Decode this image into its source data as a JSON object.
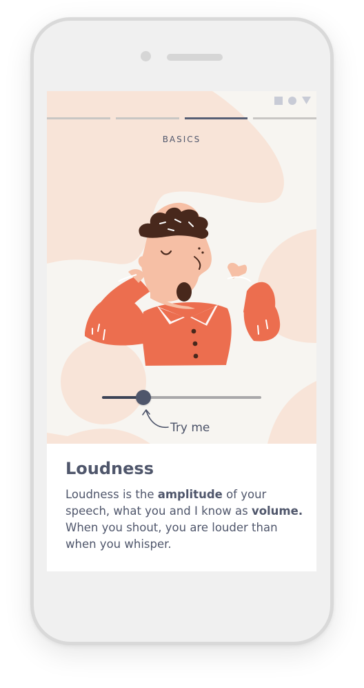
{
  "lesson": {
    "section_label": "BASICS",
    "progress": {
      "total_steps": 4,
      "current_step": 3
    },
    "illustration": "person-yawning-illustration",
    "slider": {
      "value": 0.26,
      "hint_label": "Try me"
    },
    "title": "Loudness",
    "body": {
      "part1": "Loudness is the ",
      "bold1": "amplitude",
      "part2": " of your speech, what you and I know as ",
      "bold2": "volume.",
      "part3": " When you shout, you are louder than when you whisper."
    }
  },
  "status_bar": {
    "icons": [
      "square-icon",
      "circle-icon",
      "triangle-icon"
    ],
    "icon_color": "#c8cbd6"
  },
  "colors": {
    "background": "#f7f5f1",
    "blob": "#f8e4d8",
    "shirt": "#ec6e4f",
    "skin": "#f6bfa5",
    "hair": "#48281c",
    "text": "#4f566b",
    "accent": "#565e74"
  }
}
